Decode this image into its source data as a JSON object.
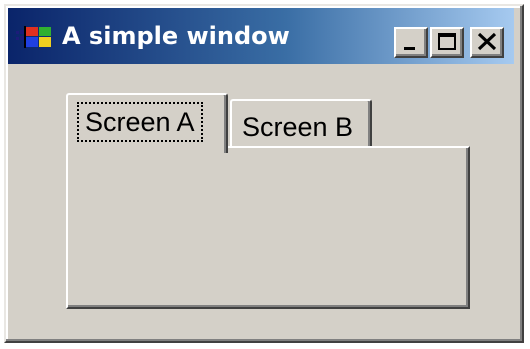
{
  "window": {
    "title": "A simple window",
    "icon": "windows-flag-icon",
    "controls": {
      "minimize": "minimize-icon",
      "maximize": "maximize-icon",
      "close": "close-icon"
    }
  },
  "tabs": [
    {
      "label": "Screen A",
      "selected": true
    },
    {
      "label": "Screen B",
      "selected": false
    }
  ],
  "colors": {
    "titlebar_start": "#0a246a",
    "titlebar_end": "#a6caf0",
    "face": "#d4d0c8"
  }
}
